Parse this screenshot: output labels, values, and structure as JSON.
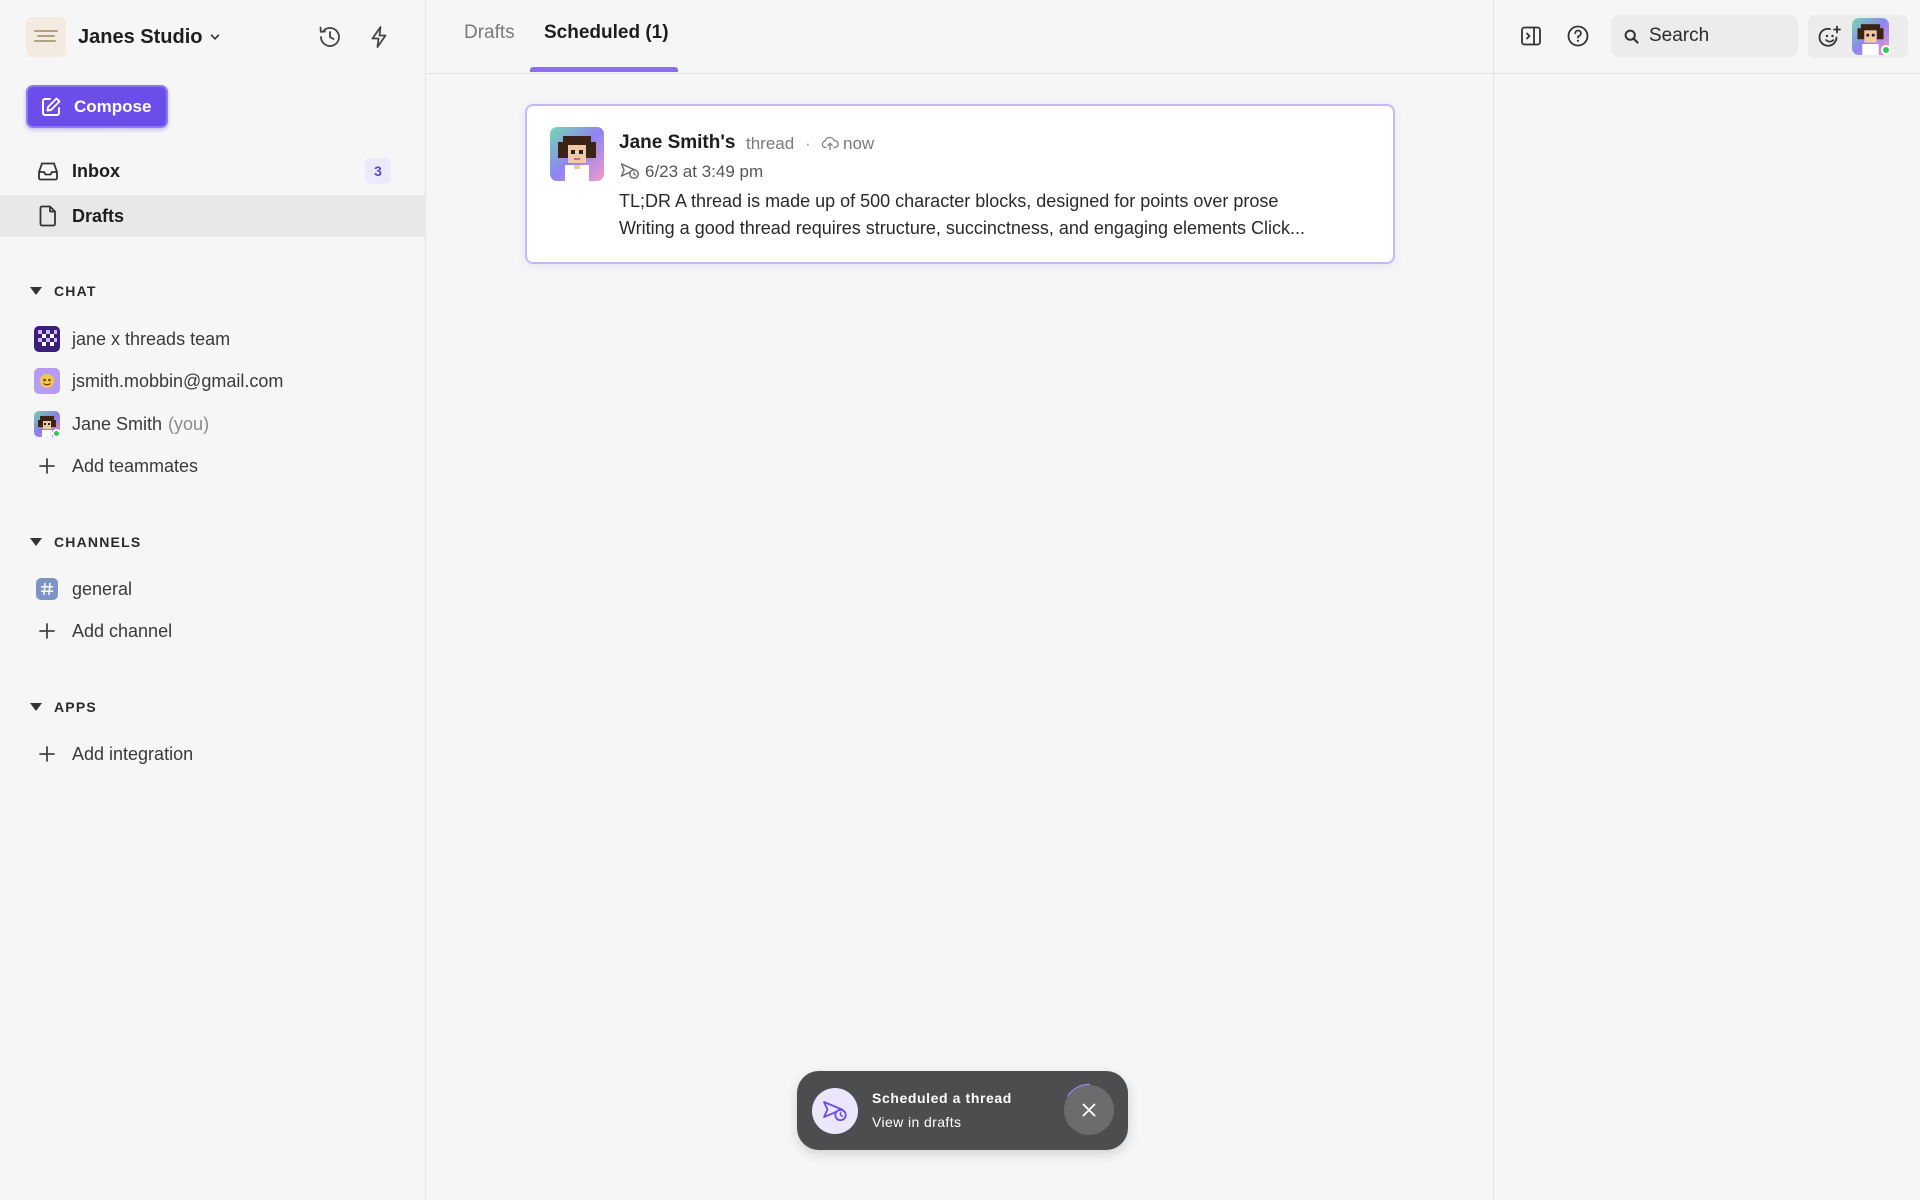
{
  "workspace": {
    "name": "Janes Studio",
    "logo_text": ""
  },
  "compose": {
    "label": "Compose"
  },
  "nav": [
    {
      "label": "Inbox",
      "badge": "3"
    },
    {
      "label": "Drafts"
    }
  ],
  "chat": {
    "title": "CHAT",
    "items": [
      {
        "label": "jane x threads team"
      },
      {
        "label": "jsmith.mobbin@gmail.com"
      },
      {
        "label": "Jane Smith",
        "suffix": "(you)"
      }
    ],
    "add_label": "Add teammates"
  },
  "channels": {
    "title": "CHANNELS",
    "items": [
      {
        "label": "general"
      }
    ],
    "add_label": "Add channel"
  },
  "apps": {
    "title": "APPS",
    "add_label": "Add integration"
  },
  "tabs": [
    {
      "label": "Drafts"
    },
    {
      "label": "Scheduled (1)"
    }
  ],
  "card": {
    "author": "Jane Smith's",
    "type": "thread",
    "separator": "·",
    "status": "now",
    "scheduled_for": "6/23 at 3:49 pm",
    "line1": "TL;DR A thread is made up of 500 character blocks, designed for points over prose",
    "line2": "Writing a good thread requires structure, succinctness, and engaging elements Click..."
  },
  "search": {
    "placeholder": "Search"
  },
  "toast": {
    "title": "Scheduled a thread",
    "link": "View in drafts"
  },
  "colors": {
    "accent": "#6b4eea",
    "accent_light": "#8b6ff0",
    "online": "#35c759",
    "toast_bg": "#4b4d4e"
  }
}
